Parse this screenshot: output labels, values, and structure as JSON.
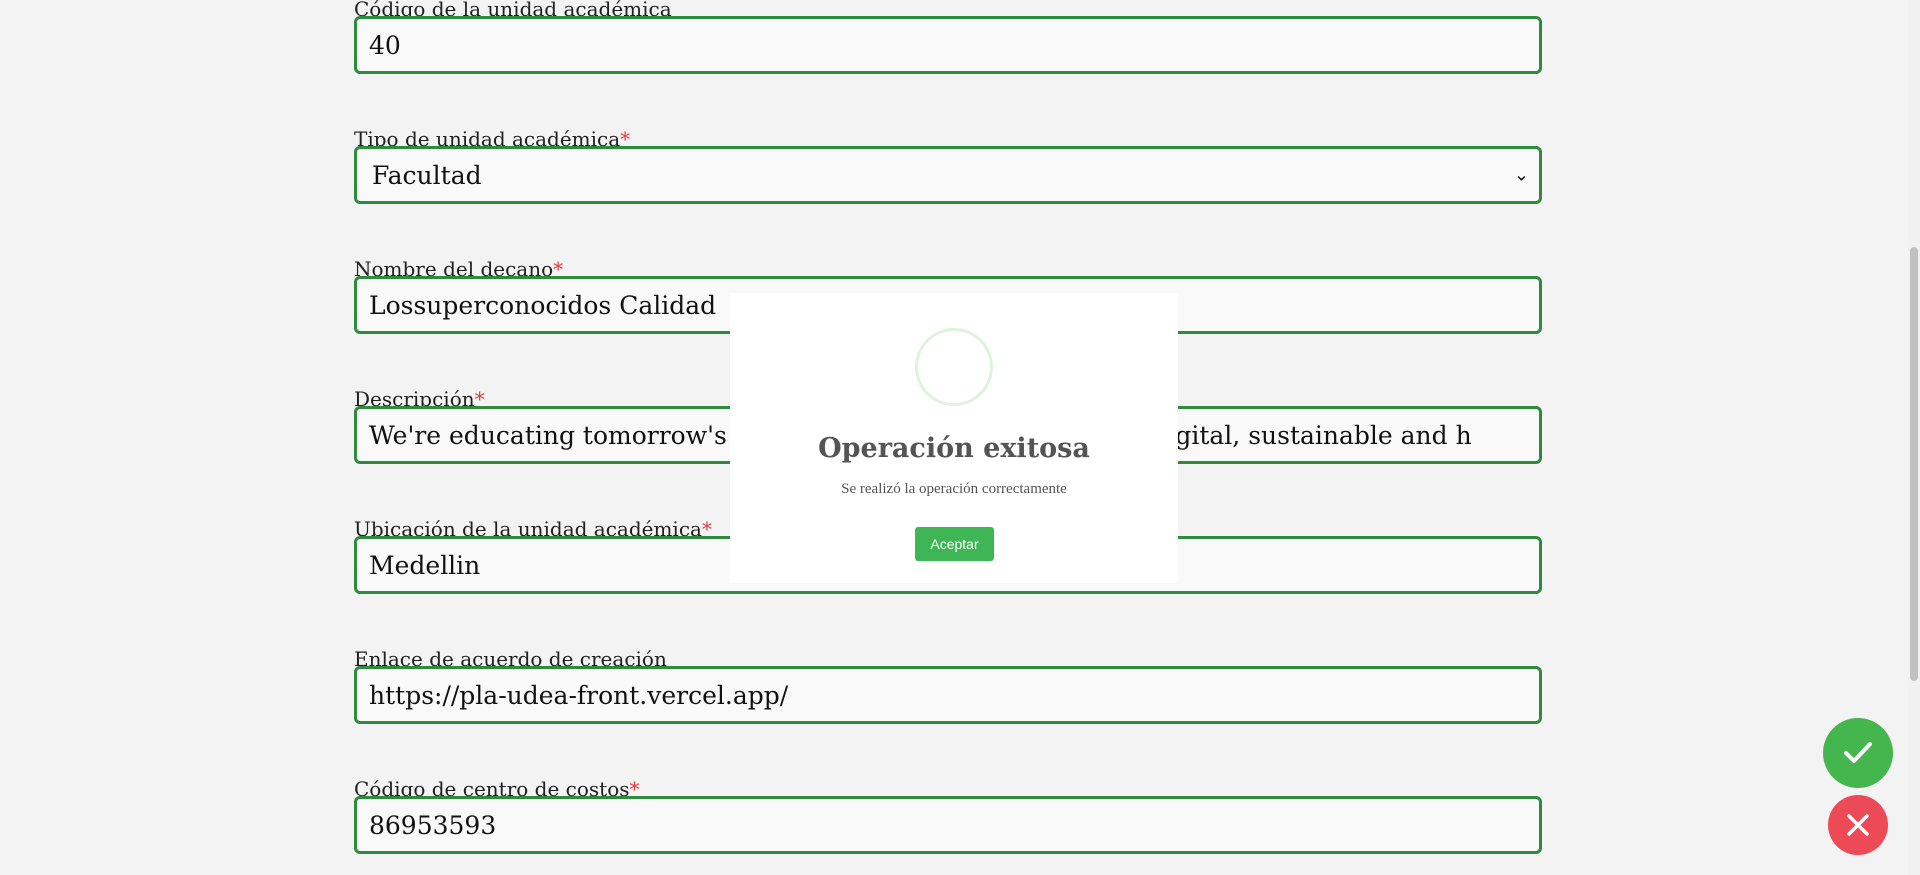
{
  "form": {
    "fields": [
      {
        "label": "Código de la unidad académica",
        "required": false,
        "value": "40",
        "kind": "input"
      },
      {
        "label": "Tipo de unidad académica",
        "required": true,
        "value": "Facultad",
        "kind": "select"
      },
      {
        "label": "Nombre del decano",
        "required": true,
        "value": "Lossuperconocidos Calidad",
        "kind": "input"
      },
      {
        "label": "Descripción",
        "required": true,
        "value": "We're educating tomorrow's leaders and pioneers, building a digital, sustainable and h",
        "kind": "input"
      },
      {
        "label": "Ubicación de la unidad académica",
        "required": true,
        "value": "Medellin",
        "kind": "input"
      },
      {
        "label": "Enlace de acuerdo de creación",
        "required": false,
        "value": "https://pla-udea-front.vercel.app/",
        "kind": "input"
      },
      {
        "label": "Código de centro de costos",
        "required": true,
        "value": "86953593",
        "kind": "input"
      }
    ],
    "required_mark": "*"
  },
  "modal": {
    "title": "Operación exitosa",
    "message": "Se realizó la operación correctamente",
    "button_label": "Aceptar",
    "icon": "success-circle-icon"
  },
  "actions": {
    "confirm_icon": "check-icon",
    "cancel_icon": "close-icon",
    "confirm_color": "#45b54e",
    "cancel_color": "#ec4a56"
  }
}
